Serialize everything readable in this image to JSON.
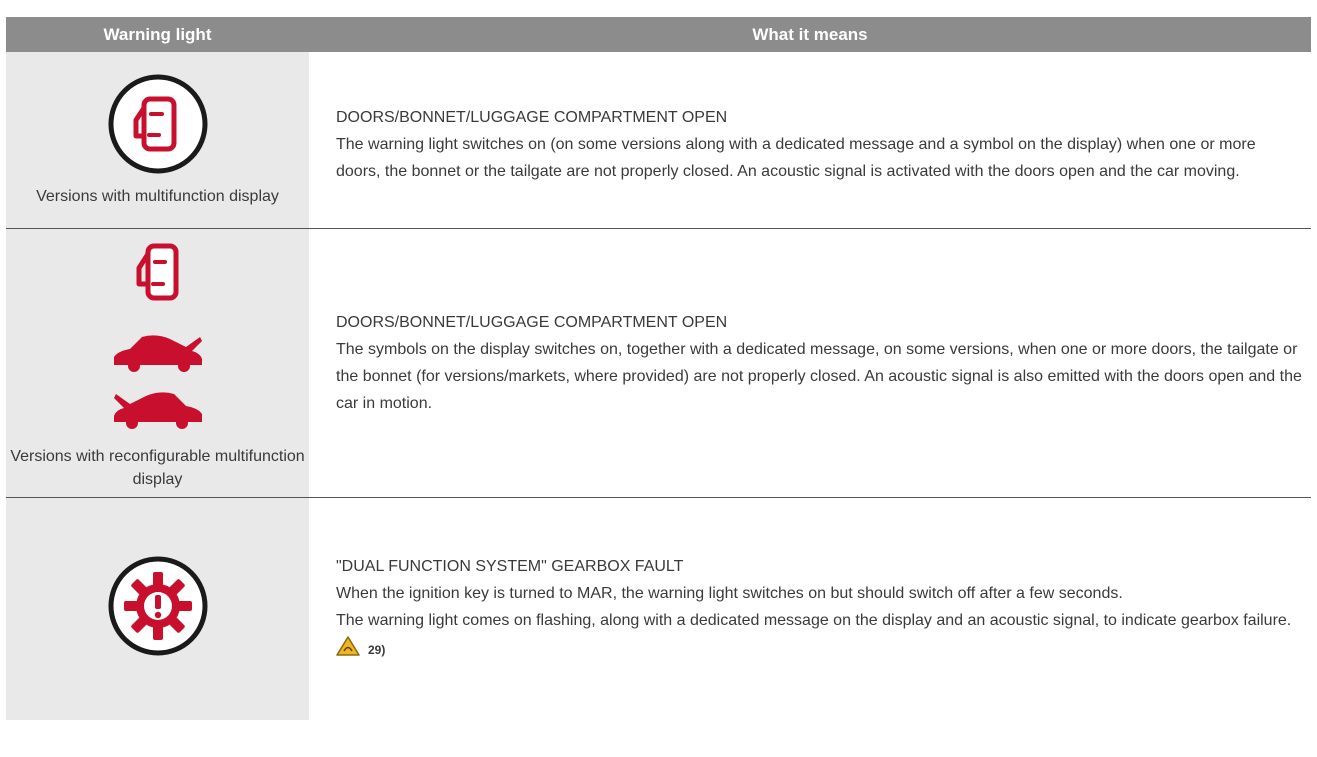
{
  "header": {
    "col_light": "Warning light",
    "col_meaning": "What it means"
  },
  "rows": [
    {
      "icons": [
        "door-open-circle-icon"
      ],
      "caption": "Versions with multifunction display",
      "title": "DOORS/BONNET/LUGGAGE COMPARTMENT OPEN",
      "paragraphs": [
        "The warning light switches on (on some versions along with a dedicated message and a symbol on the display) when one or more doors, the bonnet or the tailgate are not properly closed. An acoustic signal is activated with the doors open and the car moving."
      ]
    },
    {
      "icons": [
        "door-open-icon",
        "tailgate-open-car-icon",
        "bonnet-open-car-icon"
      ],
      "caption": "Versions with reconfigurable multifunction display",
      "title": "DOORS/BONNET/LUGGAGE COMPARTMENT OPEN",
      "paragraphs": [
        "The symbols on the display switches on, together with a dedicated message, on some versions, when one or more doors, the tailgate or the bonnet (for versions/markets, where provided) are not properly closed. An acoustic signal is also emitted with the doors open and the car in motion."
      ]
    },
    {
      "icons": [
        "gearbox-fault-icon"
      ],
      "caption": "",
      "title": "\"DUAL FUNCTION SYSTEM\" GEARBOX FAULT",
      "paragraphs": [
        "When the ignition key is turned to MAR, the warning light switches on but should switch off after a few seconds.",
        "The warning light comes on flashing, along with a dedicated message on the display and an acoustic signal, to indicate gearbox failure."
      ],
      "reference": {
        "icon": "warning-triangle-icon",
        "label": "29)"
      }
    }
  ],
  "colors": {
    "header_bg": "#8c8c8c",
    "light_cell_bg": "#e9e9e9",
    "warning_red": "#c8102e",
    "icon_black": "#1a1a1a",
    "reference_yellow": "#f2b41f"
  }
}
